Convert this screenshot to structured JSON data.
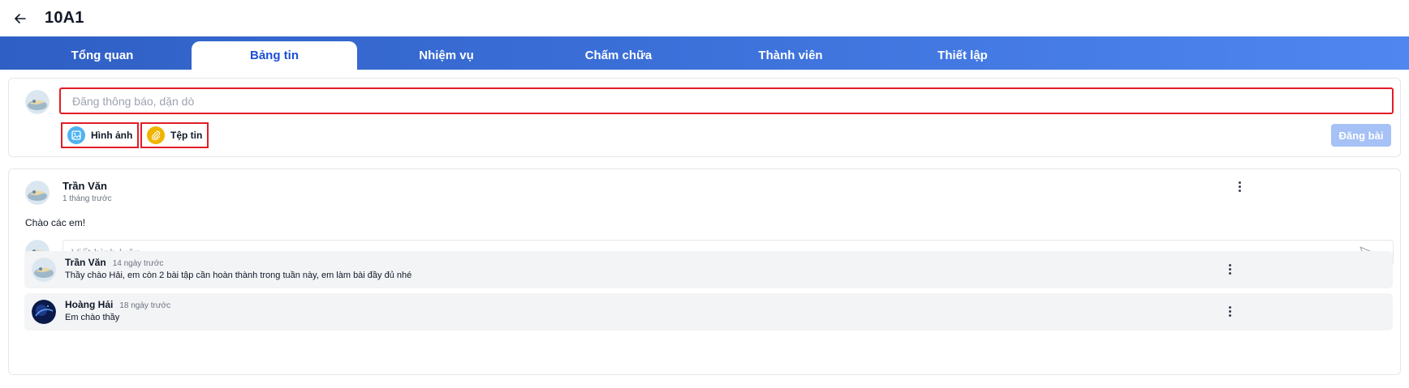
{
  "header": {
    "title": "10A1",
    "back_icon": "arrow-left-icon"
  },
  "tabs": [
    {
      "label": "Tổng quan",
      "active": false
    },
    {
      "label": "Bảng tin",
      "active": true
    },
    {
      "label": "Nhiệm vụ",
      "active": false
    },
    {
      "label": "Chấm chữa",
      "active": false
    },
    {
      "label": "Thành viên",
      "active": false
    },
    {
      "label": "Thiết lập",
      "active": false
    }
  ],
  "composer": {
    "placeholder": "Đăng thông báo, dặn dò",
    "attach_image_label": "Hình ảnh",
    "attach_file_label": "Tệp tin",
    "submit_label": "Đăng bài"
  },
  "post": {
    "author": "Trần Văn",
    "time": "1 tháng trước",
    "body": "Chào các em!",
    "comment_placeholder": "Viết bình luận",
    "comments": [
      {
        "author": "Trần Văn",
        "time": "14 ngày trước",
        "text": "Thầy chào Hải, em còn 2 bài tập cần hoàn thành trong tuần này, em làm bài đầy đủ nhé"
      },
      {
        "author": "Hoàng Hải",
        "time": "18 ngày trước",
        "text": "Em chào thầy"
      }
    ]
  },
  "colors": {
    "tab_gradient_start": "#2f5fc4",
    "tab_gradient_end": "#4f86f0",
    "highlight": "#e11d27",
    "submit_disabled": "#a5c1f5",
    "image_icon": "#4fb3f0",
    "file_icon": "#f0b400"
  }
}
